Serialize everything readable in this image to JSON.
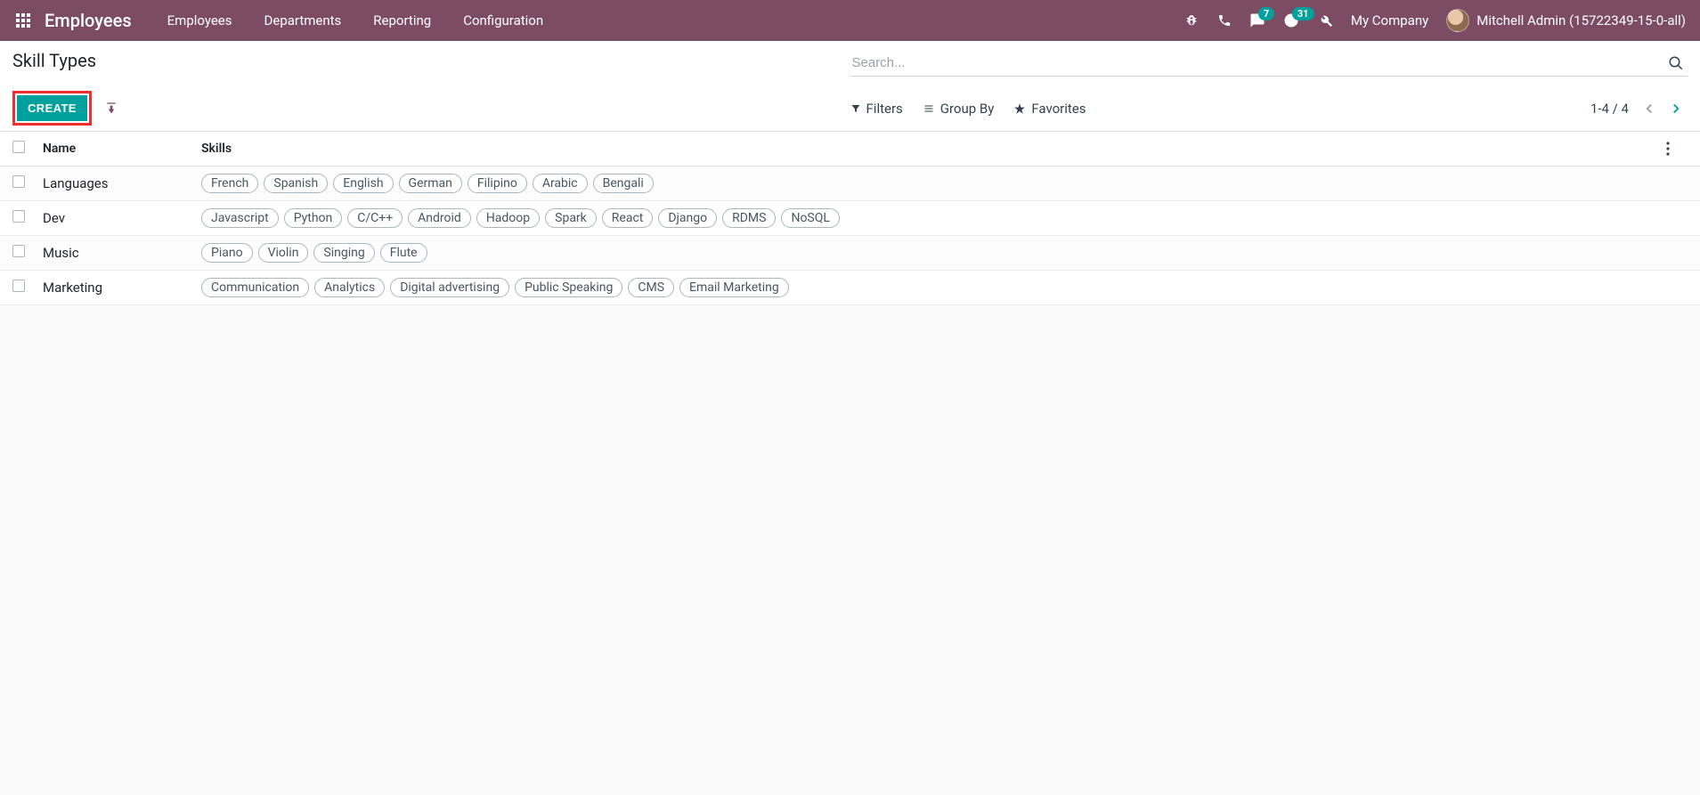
{
  "navbar": {
    "brand": "Employees",
    "links": [
      "Employees",
      "Departments",
      "Reporting",
      "Configuration"
    ],
    "messages_badge": "7",
    "activities_badge": "31",
    "company": "My Company",
    "user": "Mitchell Admin (15722349-15-0-all)"
  },
  "control_panel": {
    "title": "Skill Types",
    "create_label": "CREATE",
    "search_placeholder": "Search...",
    "filters_label": "Filters",
    "groupby_label": "Group By",
    "favorites_label": "Favorites",
    "pager": "1-4 / 4"
  },
  "table": {
    "headers": {
      "name": "Name",
      "skills": "Skills"
    },
    "rows": [
      {
        "name": "Languages",
        "skills": [
          "French",
          "Spanish",
          "English",
          "German",
          "Filipino",
          "Arabic",
          "Bengali"
        ]
      },
      {
        "name": "Dev",
        "skills": [
          "Javascript",
          "Python",
          "C/C++",
          "Android",
          "Hadoop",
          "Spark",
          "React",
          "Django",
          "RDMS",
          "NoSQL"
        ]
      },
      {
        "name": "Music",
        "skills": [
          "Piano",
          "Violin",
          "Singing",
          "Flute"
        ]
      },
      {
        "name": "Marketing",
        "skills": [
          "Communication",
          "Analytics",
          "Digital advertising",
          "Public Speaking",
          "CMS",
          "Email Marketing"
        ]
      }
    ]
  }
}
